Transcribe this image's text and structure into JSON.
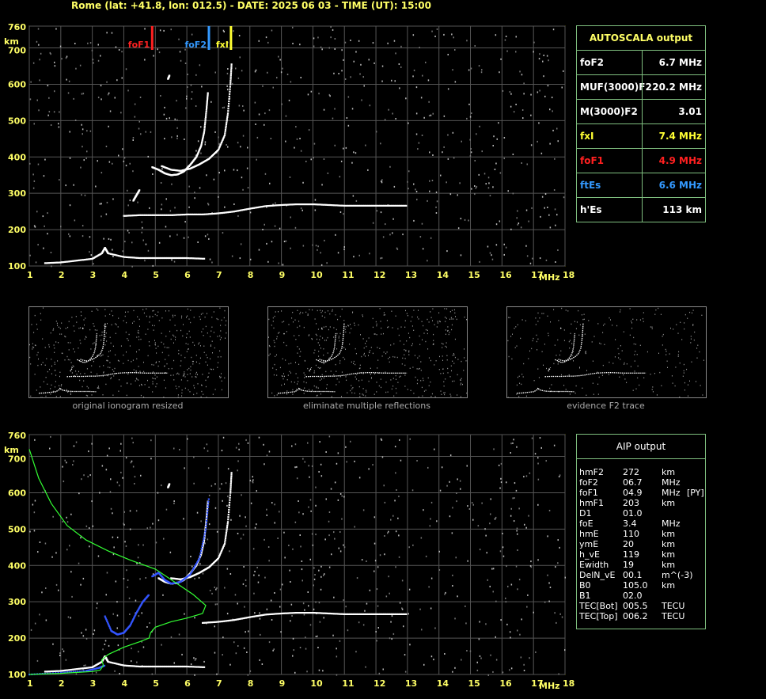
{
  "header": "Rome (lat: +41.8, lon: 012.5) - DATE: 2025 06 03 - TIME (UT): 15:00",
  "chart_data": [
    {
      "type": "scatter",
      "xlabel": "MHz",
      "ylabel": "km",
      "xlim": [
        1,
        18
      ],
      "ylim": [
        100,
        760
      ],
      "xticks": [
        "1",
        "2",
        "3",
        "4",
        "5",
        "6",
        "7",
        "8",
        "9",
        "10",
        "11",
        "12",
        "13",
        "14",
        "15",
        "16",
        "17",
        "18"
      ],
      "yticks": [
        "100",
        "200",
        "300",
        "400",
        "500",
        "600",
        "700",
        "760"
      ],
      "grid": true,
      "markers": [
        {
          "name": "foF1",
          "value": 4.9,
          "color": "#ff2020"
        },
        {
          "name": "foF2",
          "value": 6.7,
          "color": "#3399ff"
        },
        {
          "name": "fxI",
          "value": 7.4,
          "color": "#ffff33"
        }
      ],
      "series": [
        {
          "name": "Es trace",
          "points": [
            [
              1.5,
              108
            ],
            [
              2,
              110
            ],
            [
              2.5,
              115
            ],
            [
              3,
              120
            ],
            [
              3.3,
              135
            ],
            [
              3.4,
              150
            ],
            [
              3.5,
              135
            ],
            [
              4,
              125
            ],
            [
              4.5,
              122
            ],
            [
              5,
              122
            ],
            [
              5.5,
              122
            ],
            [
              6,
              122
            ],
            [
              6.6,
              120
            ]
          ]
        },
        {
          "name": "F1 lower",
          "points": [
            [
              4.3,
              280
            ],
            [
              4.4,
              295
            ],
            [
              4.5,
              310
            ]
          ]
        },
        {
          "name": "ground trace",
          "points": [
            [
              4,
              238
            ],
            [
              4.5,
              240
            ],
            [
              5,
              240
            ],
            [
              5.5,
              240
            ],
            [
              6,
              242
            ],
            [
              6.5,
              242
            ],
            [
              7,
              245
            ],
            [
              7.5,
              250
            ],
            [
              8,
              258
            ],
            [
              8.5,
              265
            ],
            [
              9,
              268
            ],
            [
              9.5,
              270
            ],
            [
              10,
              270
            ],
            [
              10.5,
              268
            ],
            [
              11,
              266
            ],
            [
              11.5,
              266
            ],
            [
              12,
              266
            ],
            [
              12.5,
              266
            ],
            [
              13,
              266
            ]
          ]
        },
        {
          "name": "F2 o-trace",
          "points": [
            [
              4.9,
              372
            ],
            [
              5.1,
              365
            ],
            [
              5.3,
              355
            ],
            [
              5.5,
              350
            ],
            [
              5.7,
              352
            ],
            [
              5.9,
              360
            ],
            [
              6.1,
              378
            ],
            [
              6.3,
              400
            ],
            [
              6.45,
              430
            ],
            [
              6.55,
              470
            ],
            [
              6.62,
              530
            ],
            [
              6.67,
              580
            ]
          ]
        },
        {
          "name": "F2 x-trace",
          "points": [
            [
              5.2,
              375
            ],
            [
              5.5,
              365
            ],
            [
              5.8,
              362
            ],
            [
              6.1,
              368
            ],
            [
              6.4,
              380
            ],
            [
              6.7,
              395
            ],
            [
              7,
              420
            ],
            [
              7.2,
              460
            ],
            [
              7.3,
              520
            ],
            [
              7.38,
              600
            ],
            [
              7.42,
              660
            ]
          ]
        },
        {
          "name": "F2 upper",
          "points": [
            [
              5.4,
              615
            ],
            [
              5.45,
              625
            ]
          ]
        }
      ]
    },
    {
      "type": "line",
      "xlabel": "MHz",
      "ylabel": "km",
      "xlim": [
        1,
        18
      ],
      "ylim": [
        100,
        760
      ],
      "xticks": [
        "1",
        "2",
        "3",
        "4",
        "5",
        "6",
        "7",
        "8",
        "9",
        "10",
        "11",
        "12",
        "13",
        "14",
        "15",
        "16",
        "17",
        "18"
      ],
      "yticks": [
        "100",
        "200",
        "300",
        "400",
        "500",
        "600",
        "700",
        "760"
      ],
      "grid": true,
      "series": [
        {
          "name": "Es trace",
          "points": [
            [
              1.5,
              108
            ],
            [
              2,
              110
            ],
            [
              2.5,
              115
            ],
            [
              3,
              120
            ],
            [
              3.3,
              135
            ],
            [
              3.4,
              150
            ],
            [
              3.5,
              135
            ],
            [
              4,
              125
            ],
            [
              4.5,
              122
            ],
            [
              5,
              122
            ],
            [
              5.5,
              122
            ],
            [
              6,
              122
            ],
            [
              6.6,
              120
            ]
          ]
        },
        {
          "name": "ground trace",
          "points": [
            [
              6.5,
              242
            ],
            [
              7,
              245
            ],
            [
              7.5,
              250
            ],
            [
              8,
              258
            ],
            [
              8.5,
              265
            ],
            [
              9,
              268
            ],
            [
              9.5,
              270
            ],
            [
              10,
              270
            ],
            [
              10.5,
              268
            ],
            [
              11,
              266
            ],
            [
              11.5,
              266
            ],
            [
              12,
              266
            ],
            [
              12.5,
              266
            ],
            [
              13,
              266
            ]
          ]
        },
        {
          "name": "F2 o-trace",
          "points": [
            [
              5.1,
              365
            ],
            [
              5.3,
              355
            ],
            [
              5.5,
              350
            ],
            [
              5.7,
              352
            ],
            [
              5.9,
              360
            ],
            [
              6.1,
              378
            ],
            [
              6.3,
              400
            ],
            [
              6.45,
              430
            ],
            [
              6.55,
              470
            ],
            [
              6.62,
              530
            ],
            [
              6.67,
              580
            ]
          ]
        },
        {
          "name": "F2 x-trace",
          "points": [
            [
              5.5,
              365
            ],
            [
              5.8,
              362
            ],
            [
              6.1,
              368
            ],
            [
              6.4,
              380
            ],
            [
              6.7,
              395
            ],
            [
              7,
              420
            ],
            [
              7.2,
              460
            ],
            [
              7.3,
              520
            ],
            [
              7.38,
              600
            ],
            [
              7.42,
              660
            ]
          ]
        },
        {
          "name": "F2 upper",
          "points": [
            [
              5.4,
              615
            ],
            [
              5.45,
              625
            ]
          ]
        },
        {
          "name": "Blue F1",
          "points": [
            [
              3.4,
              260
            ],
            [
              3.6,
              220
            ],
            [
              3.8,
              210
            ],
            [
              4,
              215
            ],
            [
              4.2,
              235
            ],
            [
              4.4,
              270
            ],
            [
              4.6,
              300
            ],
            [
              4.8,
              320
            ]
          ]
        },
        {
          "name": "Blue F2 o",
          "points": [
            [
              4.9,
              370
            ],
            [
              5.1,
              380
            ],
            [
              5.3,
              360
            ],
            [
              5.5,
              350
            ],
            [
              5.8,
              355
            ],
            [
              6.1,
              375
            ],
            [
              6.4,
              420
            ],
            [
              6.6,
              500
            ],
            [
              6.7,
              590
            ]
          ]
        },
        {
          "name": "Blue Es",
          "points": [
            [
              1,
              100
            ],
            [
              2,
              105
            ],
            [
              2.8,
              110
            ],
            [
              3.2,
              118
            ],
            [
              3.4,
              125
            ]
          ]
        },
        {
          "name": "Profile",
          "points": [
            [
              1,
              720
            ],
            [
              1.3,
              640
            ],
            [
              1.7,
              570
            ],
            [
              2.2,
              510
            ],
            [
              2.8,
              470
            ],
            [
              3.5,
              440
            ],
            [
              4.2,
              415
            ],
            [
              5,
              390
            ],
            [
              5.6,
              355
            ],
            [
              6.2,
              320
            ],
            [
              6.6,
              290
            ],
            [
              6.5,
              268
            ],
            [
              6,
              255
            ],
            [
              5.5,
              245
            ],
            [
              5,
              230
            ],
            [
              4.85,
              215
            ],
            [
              4.8,
              200
            ],
            [
              4.5,
              190
            ],
            [
              4,
              175
            ],
            [
              3.5,
              155
            ],
            [
              3.3,
              140
            ],
            [
              3.35,
              125
            ],
            [
              3.25,
              112
            ],
            [
              3,
              108
            ],
            [
              2,
              103
            ],
            [
              1,
              100
            ]
          ]
        }
      ]
    }
  ],
  "autoscala": {
    "title": "AUTOSCALA output",
    "rows": [
      {
        "k": "foF2",
        "v": "6.7 MHz",
        "color": "#ffffff"
      },
      {
        "k": "MUF(3000)F2",
        "v": "20.2 MHz",
        "color": "#ffffff"
      },
      {
        "k": "M(3000)F2",
        "v": "3.01",
        "color": "#ffffff"
      },
      {
        "k": "fxI",
        "v": "7.4 MHz",
        "color": "#ffff33"
      },
      {
        "k": "foF1",
        "v": "4.9 MHz",
        "color": "#ff2020"
      },
      {
        "k": "ftEs",
        "v": "6.6 MHz",
        "color": "#3399ff"
      },
      {
        "k": "h'Es",
        "v": "113   km",
        "color": "#ffffff"
      }
    ]
  },
  "aip": {
    "title": "AIP output",
    "rows": [
      {
        "k": "hmF2",
        "v": "272",
        "u": "km",
        "x": ""
      },
      {
        "k": "foF2",
        "v": "06.7",
        "u": "MHz",
        "x": ""
      },
      {
        "k": "foF1",
        "v": "04.9",
        "u": "MHz",
        "x": "[PY]"
      },
      {
        "k": "hmF1",
        "v": "203",
        "u": "km",
        "x": ""
      },
      {
        "k": "D1",
        "v": "01.0",
        "u": "",
        "x": ""
      },
      {
        "k": "foE",
        "v": "3.4",
        "u": "MHz",
        "x": ""
      },
      {
        "k": "hmE",
        "v": "110",
        "u": "km",
        "x": ""
      },
      {
        "k": "ymE",
        "v": "20",
        "u": "km",
        "x": ""
      },
      {
        "k": "h_vE",
        "v": "119",
        "u": "km",
        "x": ""
      },
      {
        "k": "Ewidth",
        "v": "19",
        "u": "km",
        "x": ""
      },
      {
        "k": "DelN_vE",
        "v": "00.1",
        "u": "m^(-3)",
        "x": ""
      },
      {
        "k": "B0",
        "v": "105.0",
        "u": "km",
        "x": ""
      },
      {
        "k": "B1",
        "v": "02.0",
        "u": "",
        "x": ""
      },
      {
        "k": "TEC[Bot]",
        "v": "005.5",
        "u": "TECU",
        "x": ""
      },
      {
        "k": "TEC[Top]",
        "v": "006.2",
        "u": "TECU",
        "x": ""
      }
    ]
  },
  "thumbnails": [
    {
      "caption": "original ionogram resized"
    },
    {
      "caption": "eliminate multiple reflections"
    },
    {
      "caption": "evidence F2 trace"
    }
  ]
}
